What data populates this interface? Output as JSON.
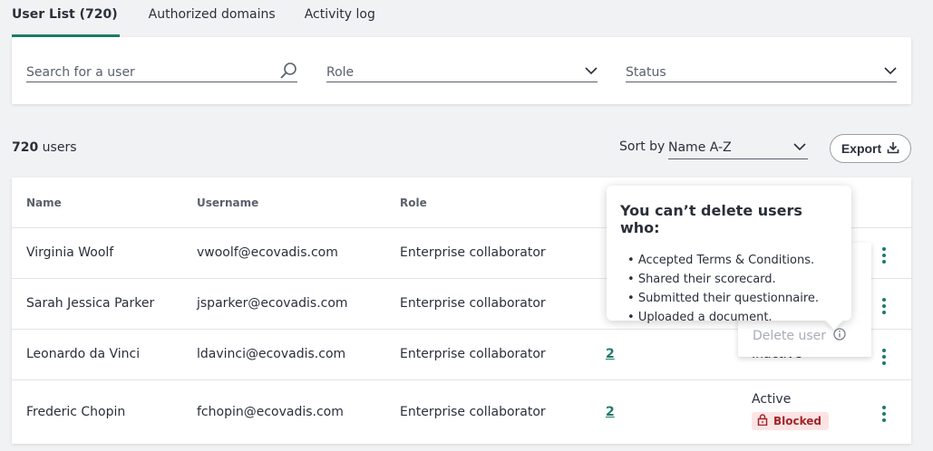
{
  "tabs": [
    {
      "label": "User List (720)",
      "active": true
    },
    {
      "label": "Authorized domains",
      "active": false
    },
    {
      "label": "Activity log",
      "active": false
    }
  ],
  "filters": {
    "search_placeholder": "Search for a user",
    "role_placeholder": "Role",
    "status_placeholder": "Status"
  },
  "summary": {
    "count": "720",
    "count_suffix": " users",
    "sort_label": "Sort by",
    "sort_value": "Name A-Z",
    "export_label": "Export"
  },
  "table": {
    "headers": {
      "name": "Name",
      "username": "Username",
      "role": "Role"
    },
    "rows": [
      {
        "name": "Virginia Woolf",
        "username": "vwoolf@ecovadis.com",
        "role": "Enterprise collaborator"
      },
      {
        "name": "Sarah Jessica Parker",
        "username": "jsparker@ecovadis.com",
        "role": "Enterprise collaborator"
      },
      {
        "name": "Leonardo da Vinci",
        "username": "ldavinci@ecovadis.com",
        "role": "Enterprise collaborator",
        "count": "2",
        "status": "Inactive"
      },
      {
        "name": "Frederic Chopin",
        "username": "fchopin@ecovadis.com",
        "role": "Enterprise collaborator",
        "count": "2",
        "status": "Active",
        "badge": "Blocked"
      }
    ]
  },
  "menu": {
    "delete_label": "Delete user"
  },
  "tooltip": {
    "title": "You can’t delete users who:",
    "items": [
      "Accepted Terms & Conditions.",
      "Shared their scorecard.",
      "Submitted their questionnaire.",
      "Uploaded a document."
    ]
  },
  "colors": {
    "accent": "#1f7a6a",
    "blocked_bg": "#fde4e4",
    "blocked_text": "#a3242a"
  }
}
